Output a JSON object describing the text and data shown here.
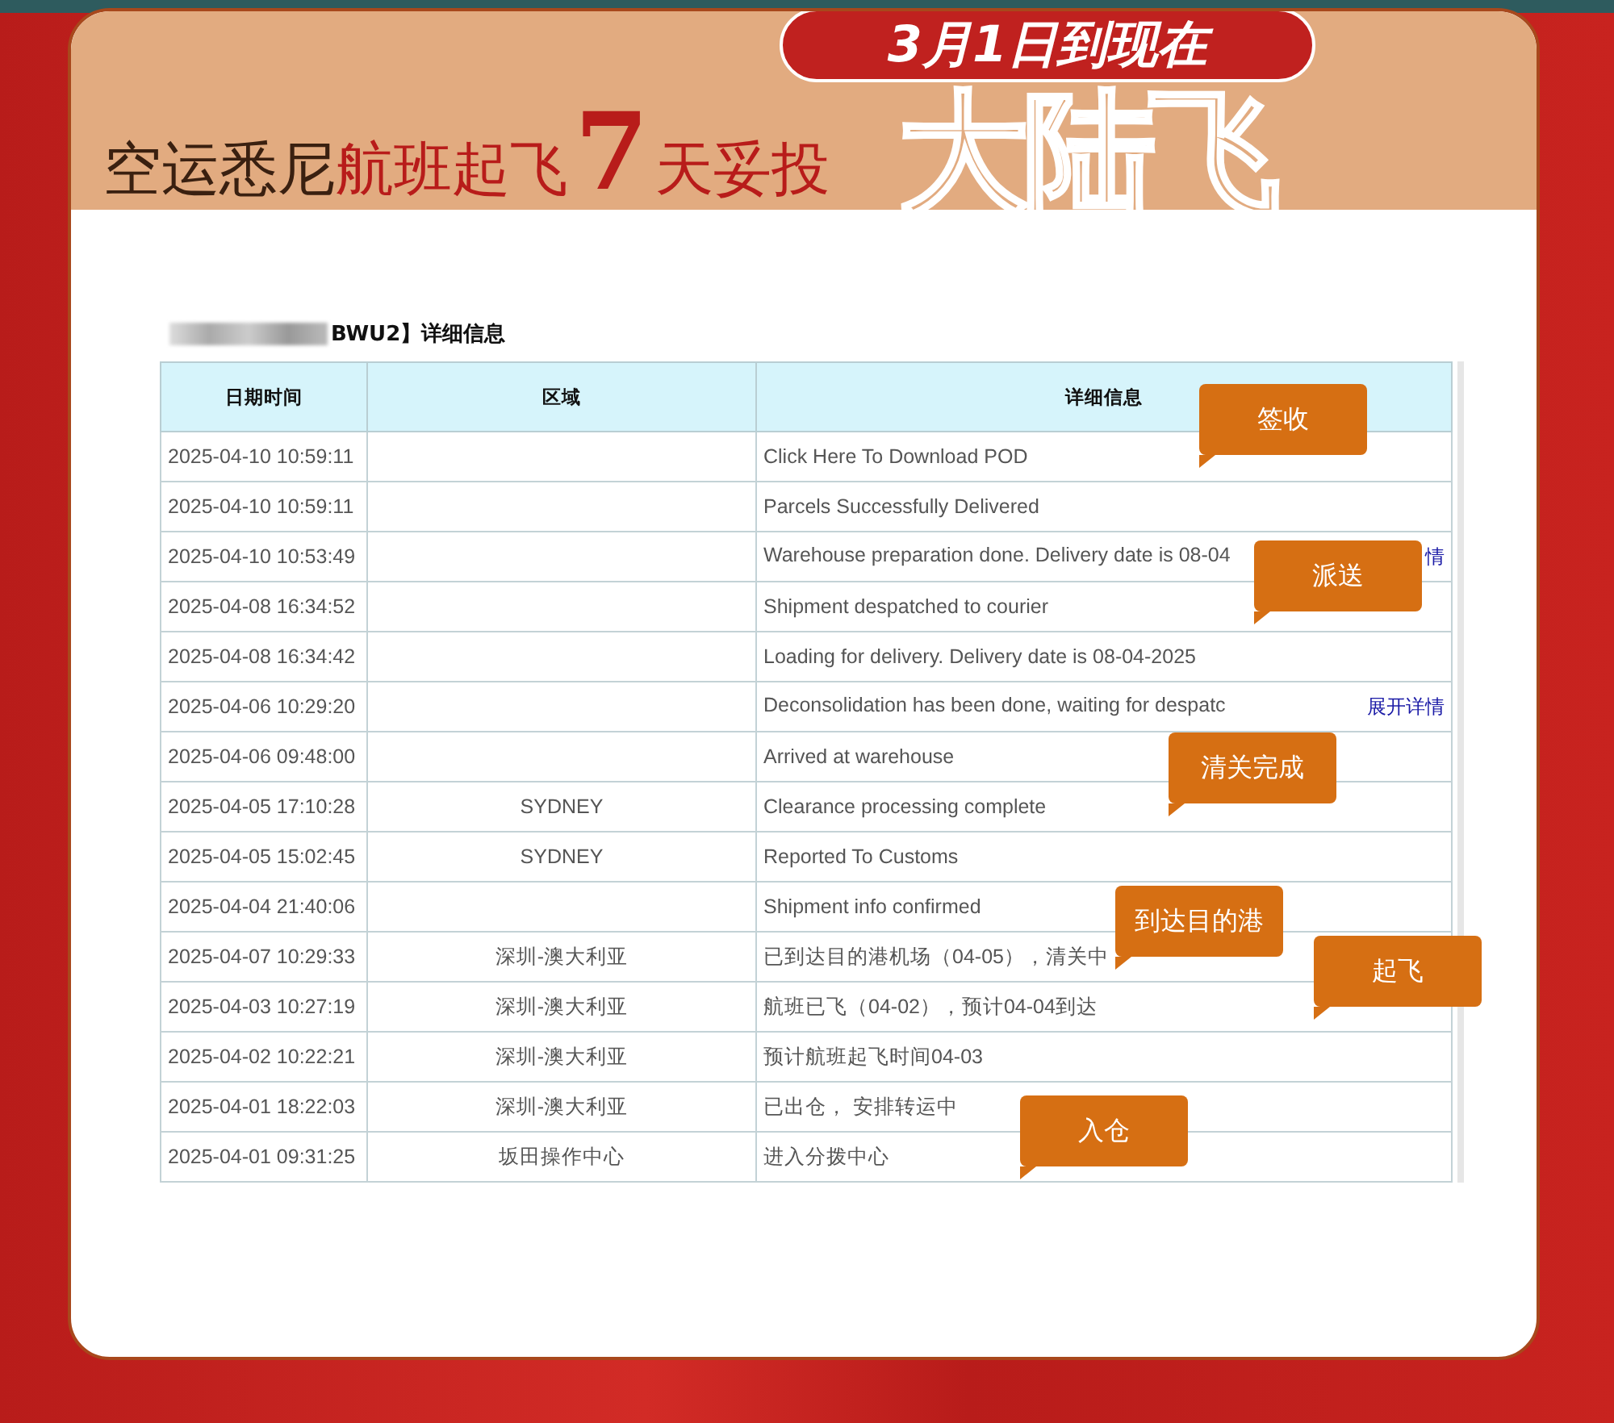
{
  "banner": {
    "pill": "3月1日到现在",
    "headline": [
      {
        "kind": "dark",
        "text": "空运悉尼"
      },
      {
        "kind": "red",
        "text": "航班起飞"
      },
      {
        "kind": "number",
        "text": "7"
      },
      {
        "kind": "red",
        "text": "天妥投"
      }
    ],
    "outline_text": "大陆飞"
  },
  "table": {
    "title": "BWU2】详细信息",
    "columns": [
      "日期时间",
      "区域",
      "详细信息"
    ],
    "rows": [
      {
        "datetime": "2025-04-10 10:59:11",
        "area": "",
        "detail": "Click Here To Download POD"
      },
      {
        "datetime": "2025-04-10 10:59:11",
        "area": "",
        "detail": "Parcels Successfully Delivered"
      },
      {
        "datetime": "2025-04-10 10:53:49",
        "area": "",
        "detail": "Warehouse preparation done. Delivery date is 08-04",
        "link": "情"
      },
      {
        "datetime": "2025-04-08 16:34:52",
        "area": "",
        "detail": "Shipment despatched to courier"
      },
      {
        "datetime": "2025-04-08 16:34:42",
        "area": "",
        "detail": "Loading for delivery. Delivery date is 08-04-2025"
      },
      {
        "datetime": "2025-04-06 10:29:20",
        "area": "",
        "detail": "Deconsolidation has been done, waiting for despatc",
        "link": "展开详情"
      },
      {
        "datetime": "2025-04-06 09:48:00",
        "area": "",
        "detail": "Arrived at warehouse"
      },
      {
        "datetime": "2025-04-05 17:10:28",
        "area": "SYDNEY",
        "detail": "Clearance processing complete"
      },
      {
        "datetime": "2025-04-05 15:02:45",
        "area": "SYDNEY",
        "detail": "Reported To Customs"
      },
      {
        "datetime": "2025-04-04 21:40:06",
        "area": "",
        "detail": "Shipment info confirmed"
      },
      {
        "datetime": "2025-04-07 10:29:33",
        "area": "深圳-澳大利亚",
        "detail": "已到达目的港机场（04-05），清关中"
      },
      {
        "datetime": "2025-04-03 10:27:19",
        "area": "深圳-澳大利亚",
        "detail": "航班已飞（04-02），预计04-04到达"
      },
      {
        "datetime": "2025-04-02 10:22:21",
        "area": "深圳-澳大利亚",
        "detail": "预计航班起飞时间04-03"
      },
      {
        "datetime": "2025-04-01 18:22:03",
        "area": "深圳-澳大利亚",
        "detail": "已出仓， 安排转运中"
      },
      {
        "datetime": "2025-04-01 09:31:25",
        "area": "坂田操作中心",
        "detail": "进入分拨中心"
      }
    ]
  },
  "callouts": [
    "签收",
    "派送",
    "清关完成",
    "到达目的港",
    "起飞",
    "入仓"
  ]
}
